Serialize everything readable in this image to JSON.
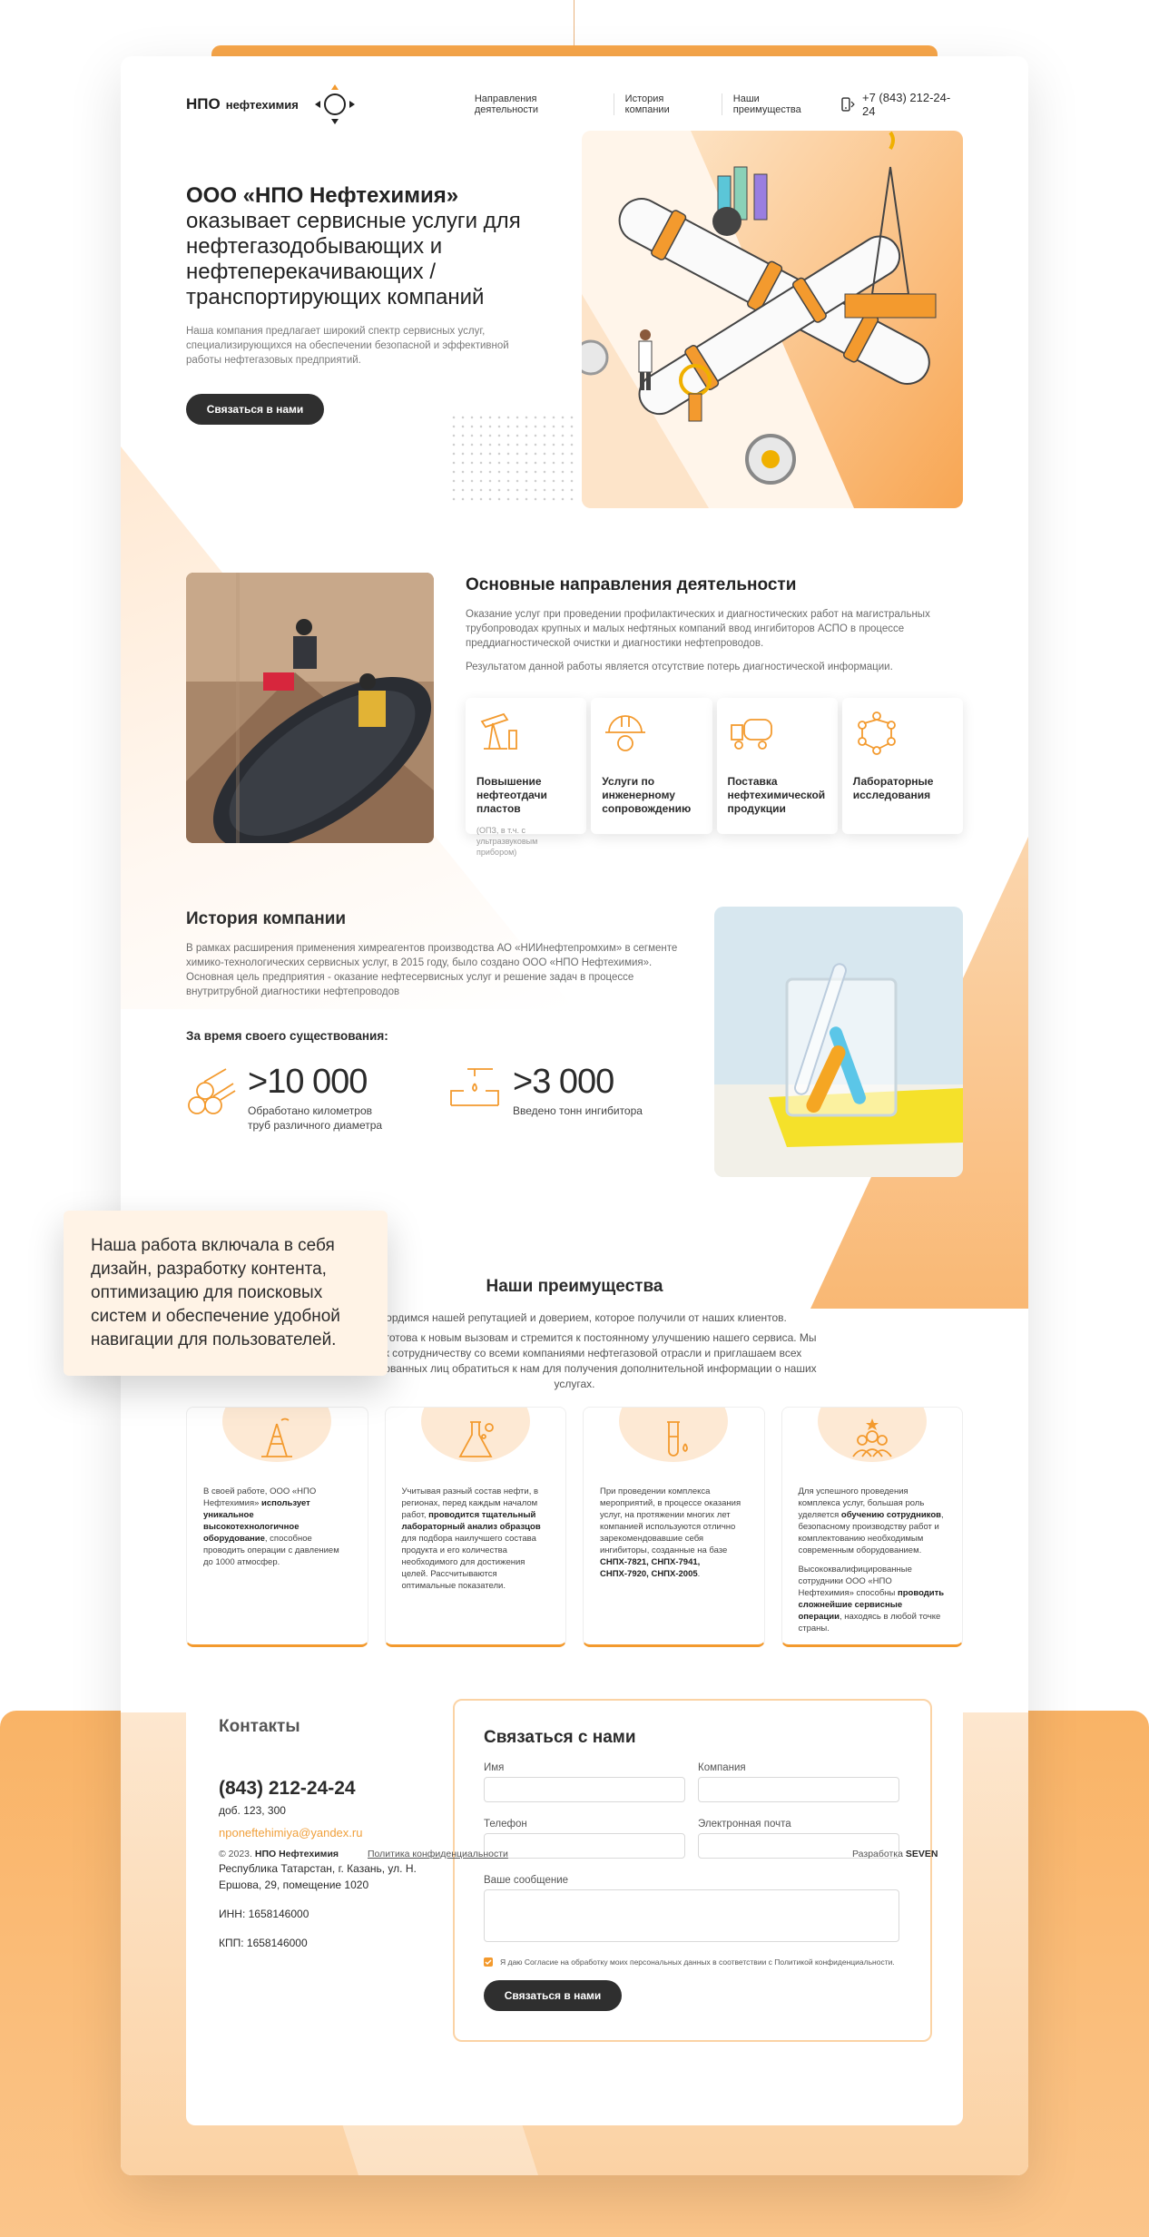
{
  "header": {
    "logo_main": "НПО",
    "logo_sub": "нефтехимия",
    "nav": [
      "Направления деятельности",
      "История компании",
      "Наши преимущества"
    ],
    "phone": "+7 (843) 212-24-24"
  },
  "hero": {
    "title_bold": "ООО «НПО Нефтехимия»",
    "title_rest": "оказывает сервисные услуги для нефтегазодобывающих и нефтеперекачивающих / транспортирующих компаний",
    "desc": "Наша компания предлагает широкий спектр сервисных услуг, специализирующихся на обеспечении безопасной и эффективной работы нефтегазовых предприятий.",
    "button": "Связаться в нами"
  },
  "directions": {
    "title": "Основные направления деятельности",
    "p1": "Оказание услуг при проведении профилактических и диагностических работ на магистральных трубопроводах крупных и малых нефтяных компаний ввод ингибиторов АСПО в процессе преддиагностической очистки и диагностики нефтепроводов.",
    "p2": "Результатом данной работы является отсутствие потерь диагностической информации.",
    "cards": [
      {
        "title": "Повышение нефтеотдачи пластов",
        "sub": "(ОПЗ, в т.ч. с ультразвуковым прибором)",
        "icon": "oil-pump-icon"
      },
      {
        "title": "Услуги по инженерному сопровождению",
        "sub": "",
        "icon": "engineer-helmet-icon"
      },
      {
        "title": "Поставка нефтехимической продукции",
        "sub": "",
        "icon": "tanker-truck-icon"
      },
      {
        "title": "Лабораторные исследования",
        "sub": "",
        "icon": "molecule-icon"
      }
    ]
  },
  "history": {
    "title": "История компании",
    "p": "В рамках расширения применения химреагентов производства АО «НИИнефтепромхим» в сегменте химико-технологических сервисных услуг, в 2015 году, было создано ООО «НПО Нефтехимия». Основная цель предприятия - оказание нефтесервисных услуг и решение задач в процессе внутритрубной диагностики нефтепроводов",
    "subtitle": "За время своего существования:",
    "stats": [
      {
        "num": ">10 000",
        "label": "Обработано километров труб различного диаметра",
        "icon": "pipes-icon"
      },
      {
        "num": ">3 000",
        "label": "Введено тонн ингибитора",
        "icon": "inhibitor-drop-icon"
      }
    ]
  },
  "advantages": {
    "title": "Наши преимущества",
    "p1": "Мы гордимся нашей репутацией и доверием, которое получили от наших клиентов.",
    "p2": "Компания готова к новым вызовам и стремится к постоянному улучшению нашего сервиса. Мы готовы к сотрудничеству со всеми компаниями нефтегазовой отрасли и приглашаем всех заинтересованных лиц обратиться к нам для получения дополнительной информации о наших услугах.",
    "cards": [
      {
        "icon": "oil-rig-icon",
        "pre": "В своей работе, ООО «НПО Нефтехимия» ",
        "bold": "использует уникальное высокотехнологичное оборудование",
        "post": ", способное проводить операции с давлением до 1000 атмосфер."
      },
      {
        "icon": "flask-icon",
        "pre": "Учитывая разный состав нефти, в регионах, перед каждым началом работ, ",
        "bold": "проводится тщательный лабораторный анализ образцов",
        "post": " для подбора наилучшего состава продукта и его количества необходимого для достижения целей. Рассчитываются оптимальные показатели."
      },
      {
        "icon": "test-tube-icon",
        "pre": "При проведении комплекса мероприятий, в процессе оказания услуг, на протяжении многих лет компанией используются отлично зарекомендовавшие себя ингибиторы, созданные на базе ",
        "bold": "СНПХ-7821, СНПХ-7941, СНПХ-7920, СНПХ-2005",
        "post": "."
      },
      {
        "icon": "team-stars-icon",
        "pre": "Для успешного проведения комплекса услуг, большая роль уделяется ",
        "bold": "обучению сотрудников",
        "post": ", безопасному производству работ и комплектованию необходимым современным оборудованием.",
        "pre2": "Высококвалифицированные сотрудники ООО «НПО Нефтехимия» способны ",
        "bold2": "проводить сложнейшие сервисные операции",
        "post2": ", находясь в любой точке страны."
      }
    ]
  },
  "contacts": {
    "title": "Контакты",
    "phone": "(843) 212-24-24",
    "ext": "доб. 123, 300",
    "email": "nponeftehimiya@yandex.ru",
    "address": "Республика Татарстан, г. Казань, ул. Н. Ершова, 29, помещение 1020",
    "inn": "ИНН: 1658146000",
    "kpp": "КПП: 1658146000"
  },
  "form": {
    "title": "Связаться с нами",
    "name_label": "Имя",
    "company_label": "Компания",
    "phone_label": "Телефон",
    "email_label": "Электронная почта",
    "message_label": "Ваше сообщение",
    "consent": "Я даю Согласие на обработку моих персональных данных в соответствии с Политикой конфиденциальности.",
    "button": "Связаться в нами"
  },
  "footer": {
    "copyright_pre": "© 2023.",
    "copyright_name": "НПО Нефтехимия",
    "policy": "Политика конфиденциальности",
    "dev_pre": "Разработка",
    "dev_name": "SEVEN"
  },
  "note": {
    "text": "Наша работа включала в себя дизайн, разработку контента, оптимизацию для поисковых систем и обеспечение удобной навигации для пользователей."
  },
  "colors": {
    "accent": "#f39a2e",
    "accent_light": "#fbd3a5",
    "dark": "#2f2f2f"
  }
}
